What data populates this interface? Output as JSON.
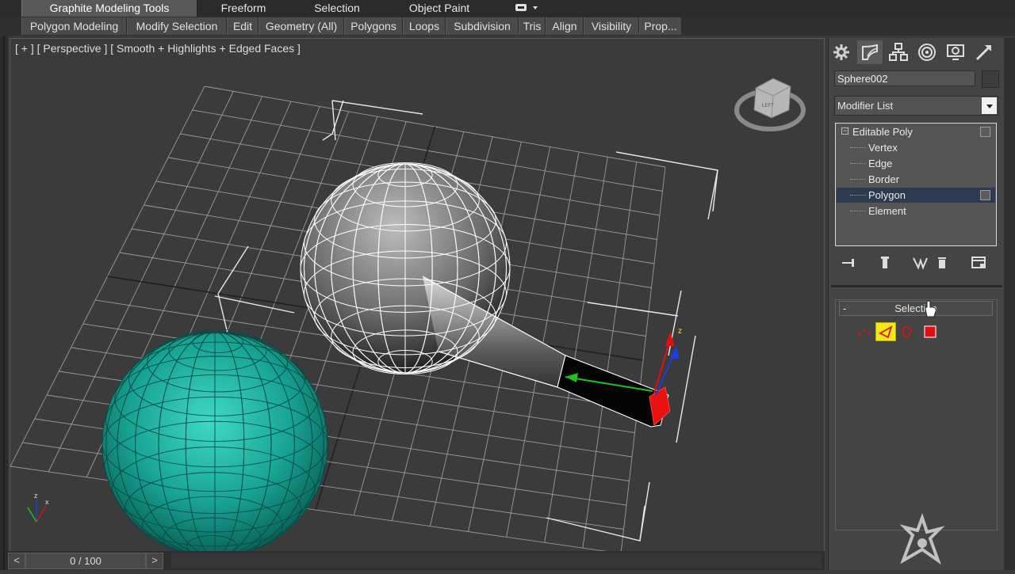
{
  "ribbon": {
    "tabs": [
      {
        "label": "Graphite Modeling Tools",
        "active": true
      },
      {
        "label": "Freeform"
      },
      {
        "label": "Selection"
      },
      {
        "label": "Object Paint"
      }
    ],
    "tools": [
      "Polygon Modeling",
      "Modify Selection",
      "Edit",
      "Geometry (All)",
      "Polygons",
      "Loops",
      "Subdivision",
      "Tris",
      "Align",
      "Visibility",
      "Prop..."
    ],
    "options_icon": "ribbon-display-icon"
  },
  "viewport": {
    "label": "[ + ] [ Perspective ] [ Smooth + Highlights + Edged Faces ]",
    "colors": {
      "grid": "#9a9a9a",
      "sphere_teal": "#1aa597",
      "wire": "#ffffff",
      "bbox": "#e8e8e8",
      "gizmo_x": "#e01010",
      "gizmo_y": "#20c020",
      "gizmo_z": "#1a40e0"
    }
  },
  "timeline": {
    "frame": "0 / 100",
    "prev": "<",
    "next": ">"
  },
  "command_panel": {
    "tabs": [
      "create-icon",
      "modify-icon",
      "hierarchy-icon",
      "motion-icon",
      "display-icon",
      "utilities-icon"
    ],
    "object_name": "Sphere002",
    "modifier_list": "Modifier List",
    "stack": [
      {
        "label": "Editable Poly",
        "level": 0,
        "has_toggle": true
      },
      {
        "label": "Vertex",
        "level": 1
      },
      {
        "label": "Edge",
        "level": 1
      },
      {
        "label": "Border",
        "level": 1
      },
      {
        "label": "Polygon",
        "level": 1,
        "selected": true,
        "has_toggle": true
      },
      {
        "label": "Element",
        "level": 1
      }
    ],
    "stack_tools": [
      "pin-stack-icon",
      "show-end-result-icon",
      "make-unique-icon",
      "remove-modifier-icon",
      "configure-sets-icon"
    ],
    "rollout": {
      "toggle": "-",
      "title": "Selection",
      "icons": [
        "vertex-mode-icon",
        "edge-mode-icon",
        "border-mode-icon",
        "polygon-mode-icon",
        "element-mode-icon"
      ],
      "active_icon": "polygon-mode-icon"
    }
  }
}
